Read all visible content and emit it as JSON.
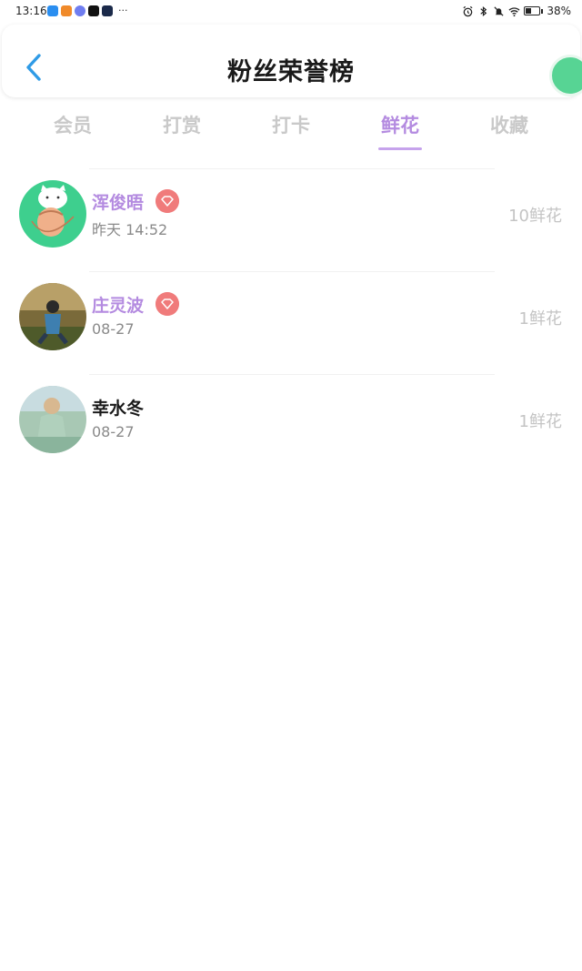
{
  "status_bar": {
    "time": "13:16",
    "more": "···",
    "battery": "38%",
    "battery_level": 0.38
  },
  "header": {
    "title": "粉丝荣誉榜"
  },
  "tabs": [
    {
      "label": "会员"
    },
    {
      "label": "打赏"
    },
    {
      "label": "打卡"
    },
    {
      "label": "鲜花"
    },
    {
      "label": "收藏"
    }
  ],
  "active_tab": "鲜花",
  "colors": {
    "accent": "#b48be0",
    "badge": "#f07b7b",
    "back_arrow": "#2f9be6"
  },
  "list": [
    {
      "name": "浑俊晤",
      "time": "昨天 14:52",
      "count": "10鲜花"
    },
    {
      "name": "庄灵波",
      "time": "08-27",
      "count": "1鲜花"
    },
    {
      "name": "幸水冬",
      "time": "08-27",
      "count": "1鲜花"
    }
  ]
}
